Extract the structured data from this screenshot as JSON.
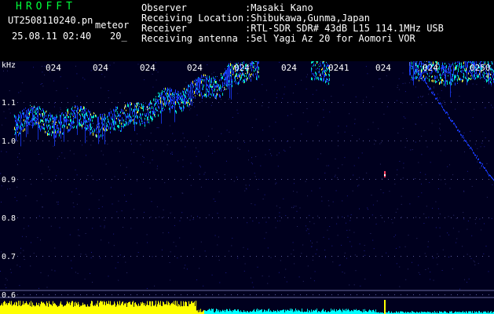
{
  "app": {
    "logo_text": "HROFFT",
    "filename": "UT2508110240.pn",
    "event_label": "meteor",
    "timestamp": "25.08.11 02:40",
    "count_label": "20_"
  },
  "station_info": [
    {
      "label": "Observer",
      "value": ":Masaki Kano"
    },
    {
      "label": "Receiving Location",
      "value": ":Shibukawa,Gunma,Japan"
    },
    {
      "label": "Receiver",
      "value": ":RTL-SDR SDR# 43dB L15 114.1MHz USB"
    },
    {
      "label": "Receiving antenna",
      "value": ":5el Yagi Az 20 for Aomori VOR"
    }
  ],
  "spectrogram": {
    "unit_label": "kHz",
    "y_ticks": [
      "1.1",
      "1.0",
      "0.9",
      "0.8",
      "0.7",
      "0.6"
    ],
    "y_tick_values": [
      1.1,
      1.0,
      0.9,
      0.8,
      0.7,
      0.6
    ],
    "x_ticks": [
      "024",
      "024",
      "024",
      "024",
      "024",
      "024",
      "0241",
      "024",
      "024",
      "0250"
    ],
    "colors": {
      "background": "#00001e",
      "signal_low": "#1a3cff",
      "signal_mid": "#00e6c8",
      "signal_high": "#ffff40",
      "axis_text": "#ffffff",
      "level_bar_yellow": "#ffff00",
      "level_bar_cyan": "#00ffff"
    }
  }
}
